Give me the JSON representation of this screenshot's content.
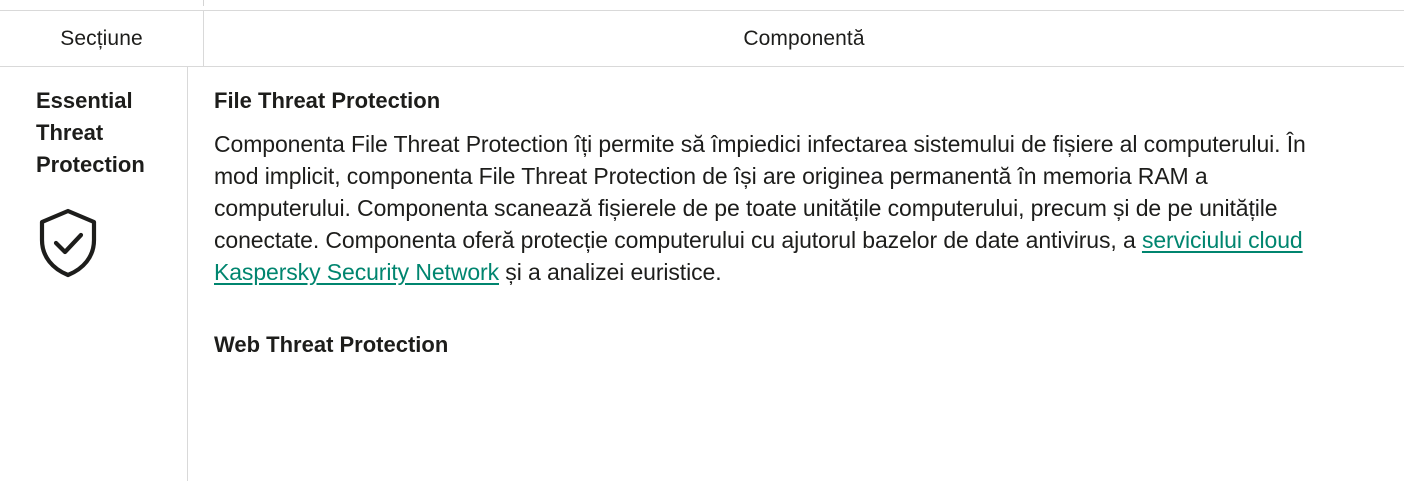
{
  "table": {
    "headers": {
      "section": "Secțiune",
      "component": "Componentă"
    },
    "rows": [
      {
        "section": "Essential Threat Protection",
        "section_icon": "shield-check-icon",
        "components": [
          {
            "title": "File Threat Protection",
            "description_before_link": "Componenta File Threat Protection îți permite să împiedici infectarea sistemului de fișiere al computerului. În mod implicit, componenta File Threat Protection de își are originea permanentă în memoria RAM a computerului. Componenta scanează fișierele de pe toate unitățile computerului, precum și de pe unitățile conectate. Componenta oferă protecție computerului cu ajutorul bazelor de date antivirus, a ",
            "link_text": "serviciului cloud Kaspersky Security Network",
            "description_after_link": " și a analizei euristice."
          },
          {
            "title": "Web Threat Protection"
          }
        ]
      }
    ]
  },
  "colors": {
    "text": "#1d1d1b",
    "link": "#00856f",
    "border": "#d9d9d9"
  }
}
